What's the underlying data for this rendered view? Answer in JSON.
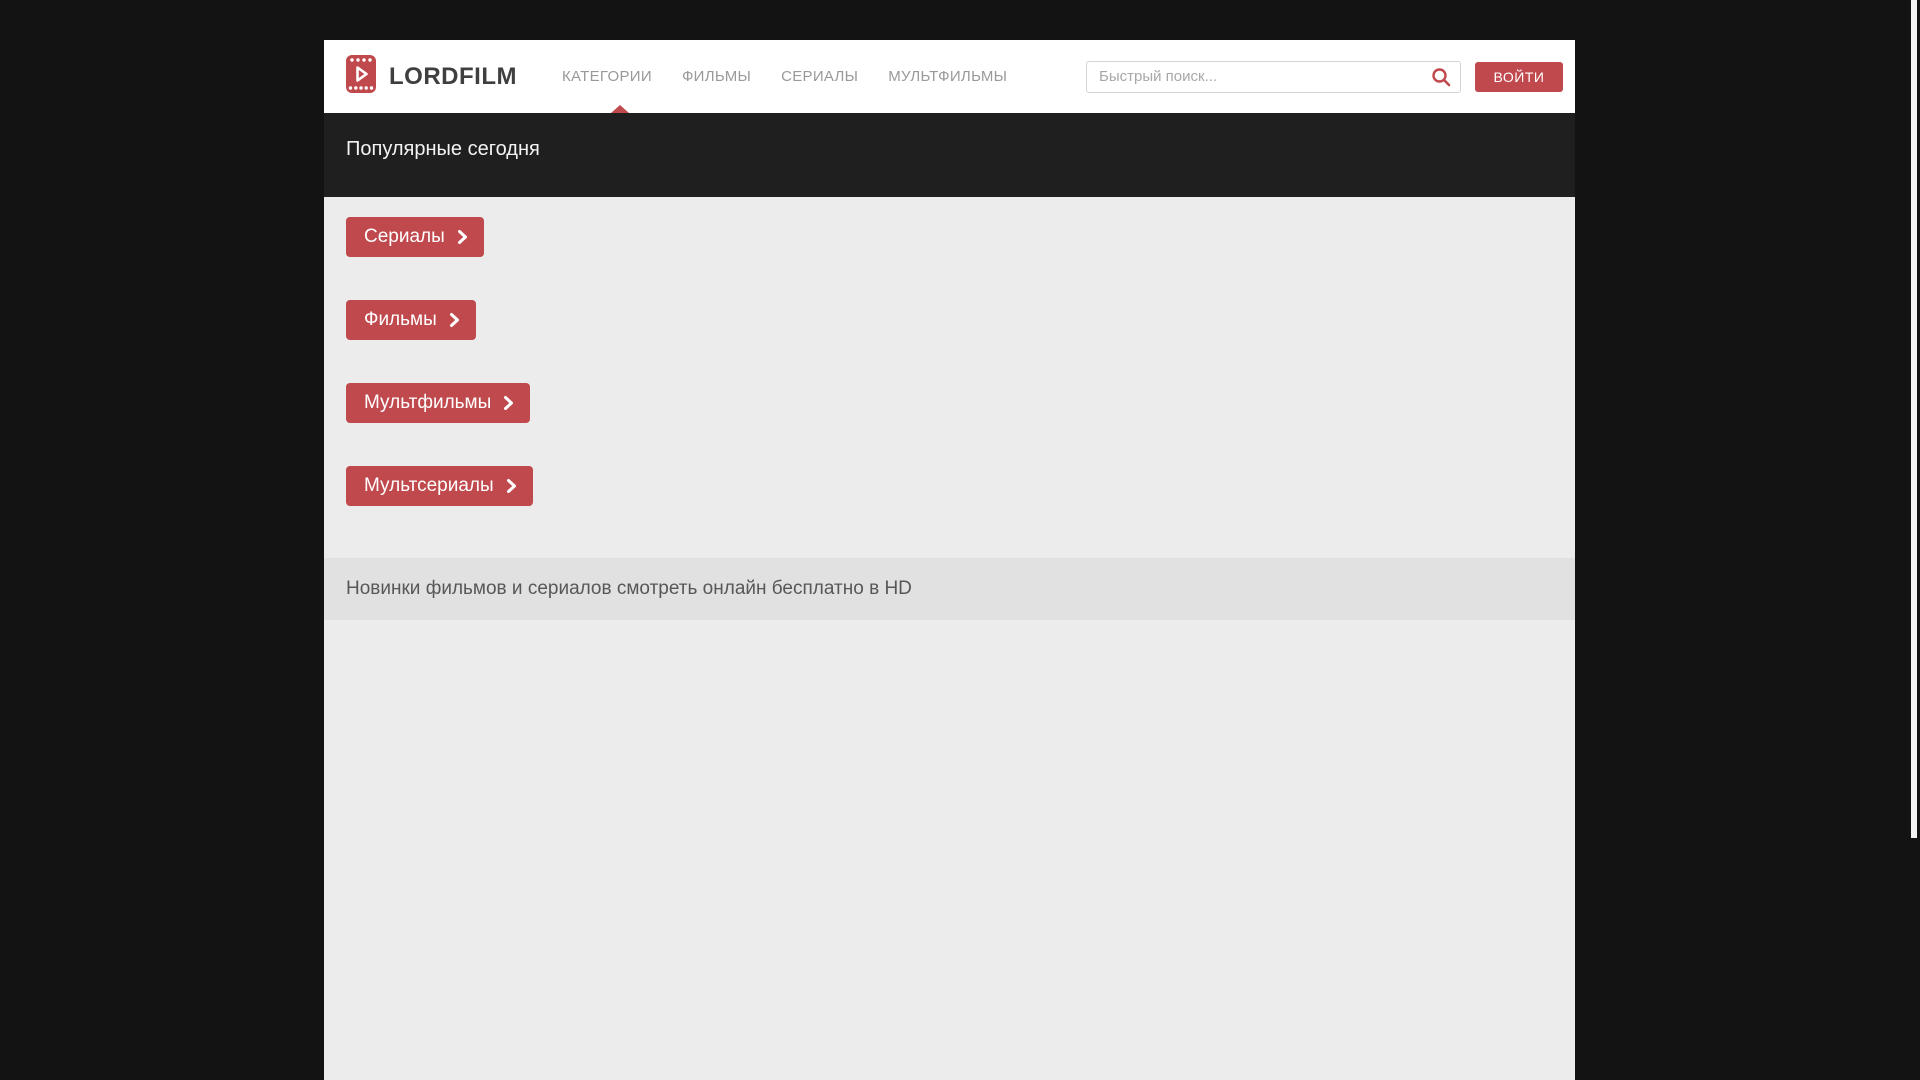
{
  "page": {
    "background": "#131313",
    "accent_red": "#c0494d",
    "dark_band": "#1f1f1f",
    "light_section": "#ececec",
    "strip_gray": "#e1e1e1"
  },
  "header": {
    "logo": {
      "text": "LORDFILM",
      "icon": "film-play-icon"
    },
    "nav": [
      {
        "label": "КАТЕГОРИИ",
        "active": true
      },
      {
        "label": "ФИЛЬМЫ",
        "active": false
      },
      {
        "label": "СЕРИАЛЫ",
        "active": false
      },
      {
        "label": "МУЛЬТФИЛЬМЫ",
        "active": false
      }
    ],
    "search": {
      "placeholder": "Быстрый поиск...",
      "value": "",
      "icon": "search-icon"
    },
    "login_label": "ВОЙТИ"
  },
  "popular": {
    "title": "Популярные сегодня"
  },
  "categories": {
    "buttons": [
      {
        "label": "Сериалы",
        "icon": "chevron-right-icon"
      },
      {
        "label": "Фильмы",
        "icon": "chevron-right-icon"
      },
      {
        "label": "Мультфильмы",
        "icon": "chevron-right-icon"
      },
      {
        "label": "Мультсериалы",
        "icon": "chevron-right-icon"
      }
    ]
  },
  "new_releases": {
    "title": "Новинки фильмов и сериалов смотреть онлайн бесплатно в HD"
  }
}
